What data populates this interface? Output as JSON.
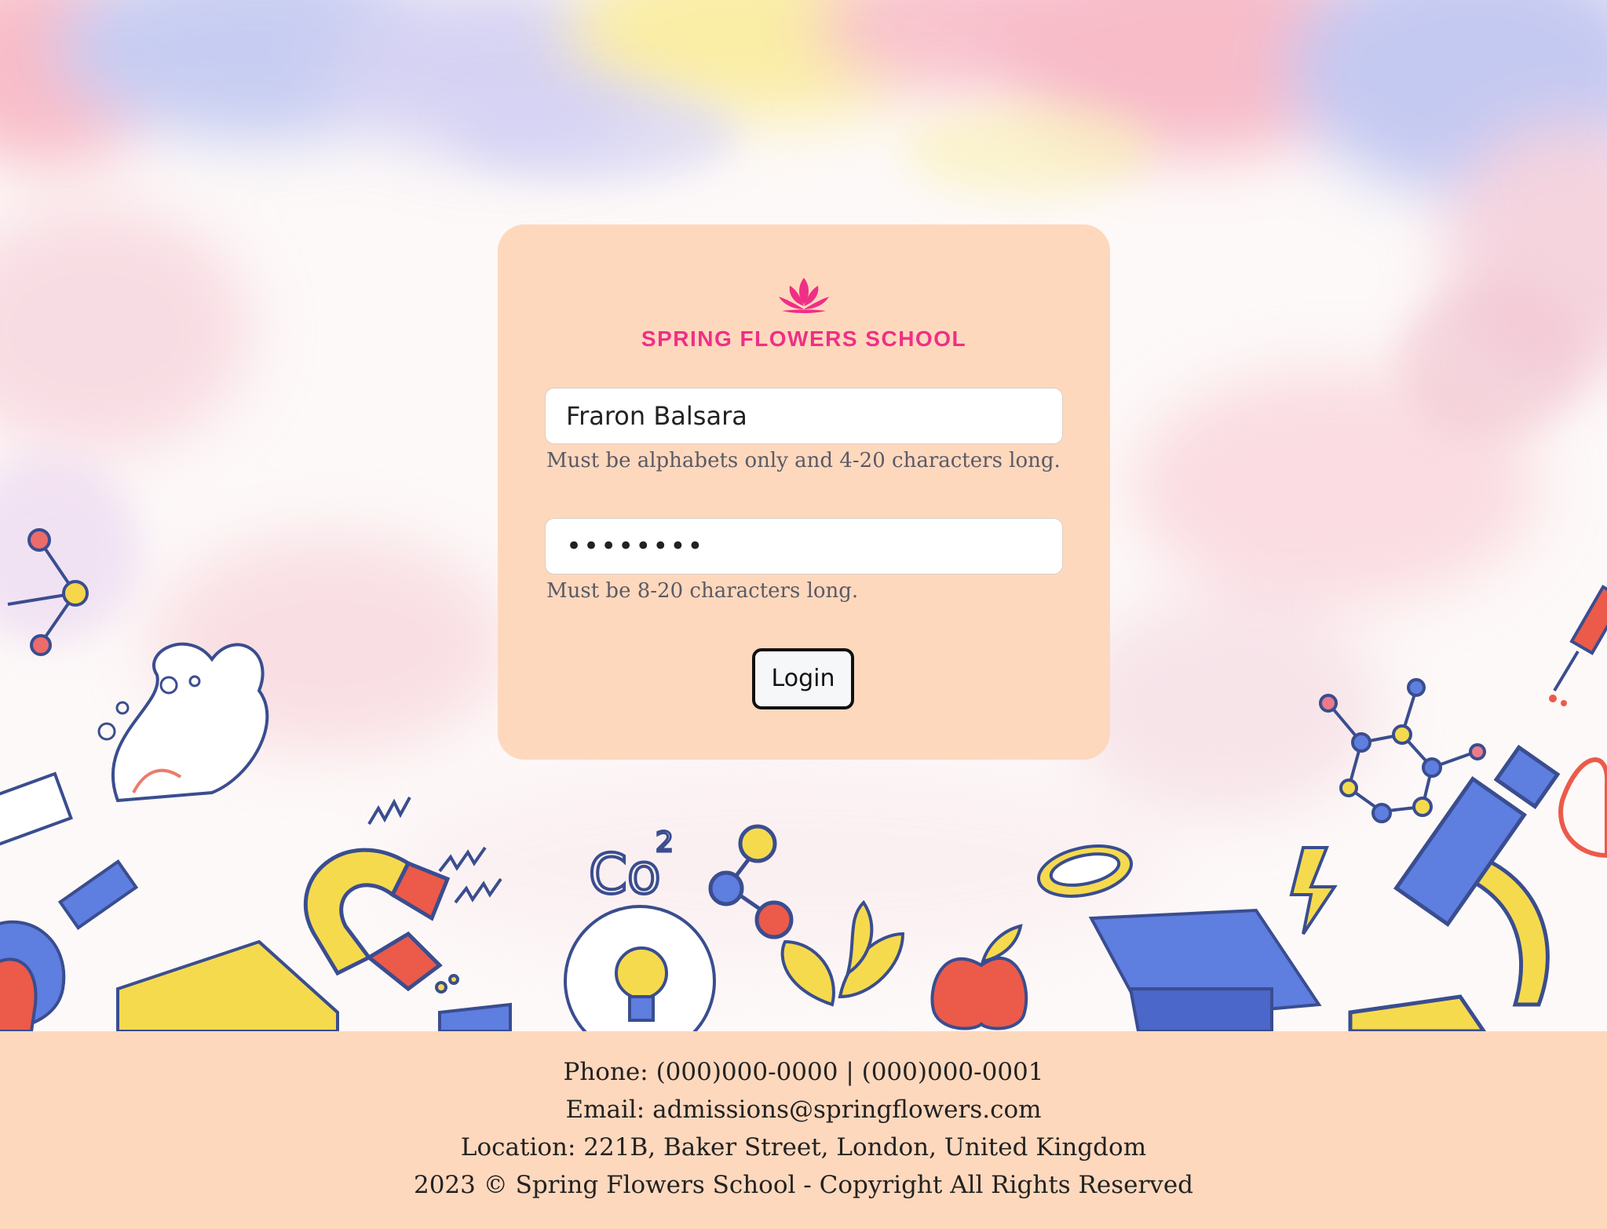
{
  "school": {
    "name": "SPRING FLOWERS SCHOOL",
    "logo_icon": "lotus-icon",
    "brand_color": "#ef2f86"
  },
  "login_form": {
    "username_value": "Fraron Balsara",
    "username_hint": "Must be alphabets only and 4-20 characters long.",
    "password_value": "••••••••",
    "password_hint": "Must be 8-20 characters long.",
    "login_label": "Login"
  },
  "footer": {
    "phone": "Phone: (000)000-0000 | (000)000-0001",
    "email": "Email: admissions@springflowers.com",
    "location": "Location: 221B, Baker Street, London, United Kingdom",
    "copyright": "2023 © Spring Flowers School - Copyright All Rights Reserved"
  },
  "colors": {
    "card_bg": "#fed8bd",
    "footer_bg": "#fed8bd"
  }
}
